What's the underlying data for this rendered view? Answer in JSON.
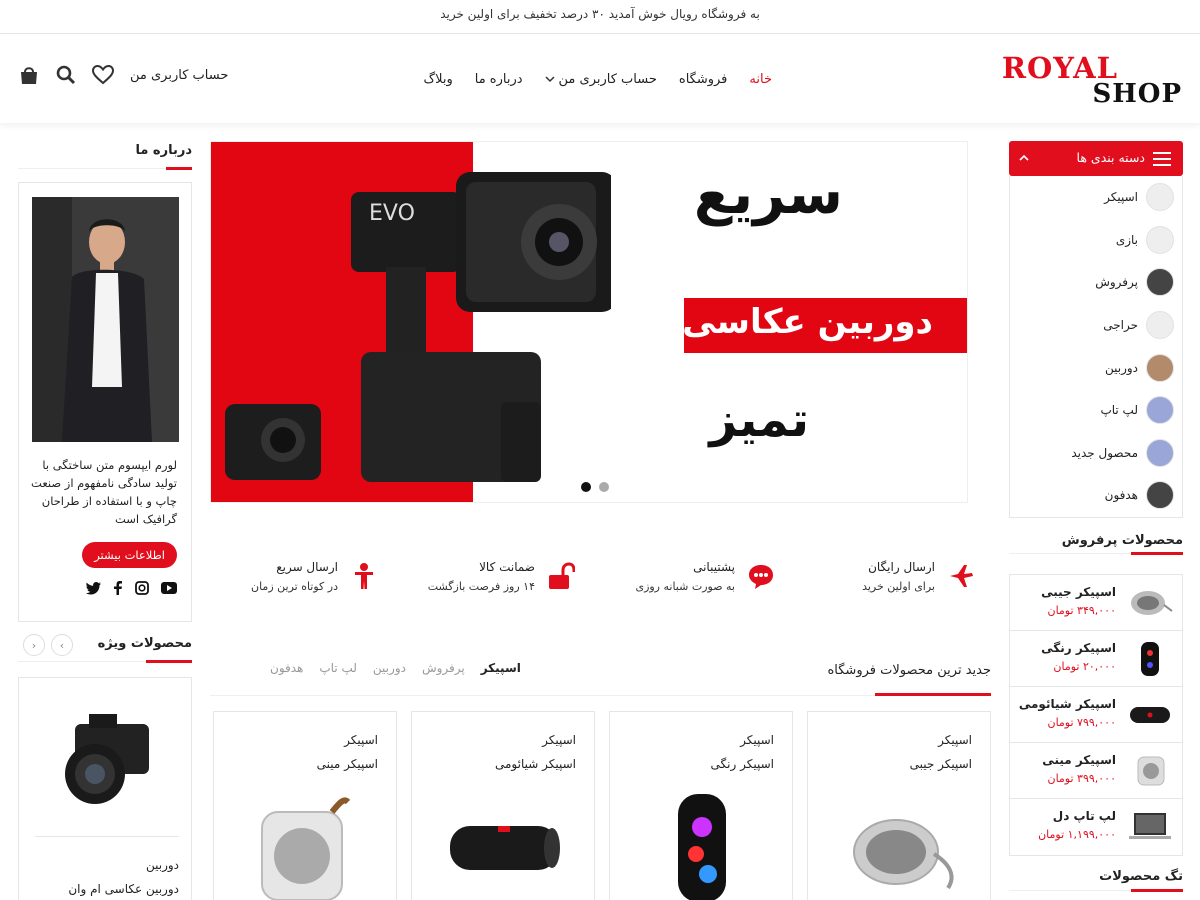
{
  "topbar": {
    "text": "به فروشگاه رویال خوش آمدید ۳۰ درصد تخفیف برای اولین خرید"
  },
  "header": {
    "logo_top": "ROYAL",
    "logo_bottom": "SHOP",
    "nav": [
      "خانه",
      "فروشگاه",
      "حساب کاربری من",
      "درباره ما",
      "وبلاگ"
    ],
    "account_label": "حساب کاربری من"
  },
  "categories": {
    "title": "دسته بندی ها",
    "items": [
      "اسپیکر",
      "بازی",
      "پرفروش",
      "حراجی",
      "دوربین",
      "لپ تاپ",
      "محصول جدید",
      "هدفون"
    ]
  },
  "bestsellers": {
    "title": "محصولات پرفروش",
    "items": [
      {
        "name": "اسپیکر جیبی",
        "price": "۳۴۹,۰۰۰ تومان"
      },
      {
        "name": "اسپیکر رنگی",
        "price": "۲۰,۰۰۰ تومان"
      },
      {
        "name": "اسپیکر شیائومی",
        "price": "۷۹۹,۰۰۰ تومان"
      },
      {
        "name": "اسپیکر مینی",
        "price": "۳۹۹,۰۰۰ تومان"
      },
      {
        "name": "لپ تاپ دل",
        "price": "۱,۱۹۹,۰۰۰ تومان"
      }
    ]
  },
  "tags": {
    "title": "تگ محصولات"
  },
  "slider": {
    "headline_1": "سریع",
    "headline_2": "دوربین عکاسی",
    "headline_3": "تمیز"
  },
  "features": [
    {
      "title": "ارسال رایگان",
      "sub": "برای اولین خرید"
    },
    {
      "title": "پشتیبانی",
      "sub": "به صورت شبانه روزی"
    },
    {
      "title": "ضمانت کالا",
      "sub": "۱۴ روز فرصت بازگشت"
    },
    {
      "title": "ارسال سریع",
      "sub": "در کوتاه ترین زمان"
    }
  ],
  "latest": {
    "title": "جدید ترین محصولات فروشگاه",
    "tabs": [
      "اسپیکر",
      "پرفروش",
      "دوربین",
      "لپ تاپ",
      "هدفون"
    ],
    "products": [
      {
        "cat": "اسپیکر",
        "name": "اسپیکر جیبی"
      },
      {
        "cat": "اسپیکر",
        "name": "اسپیکر رنگی"
      },
      {
        "cat": "اسپیکر",
        "name": "اسپیکر شیائومی"
      },
      {
        "cat": "اسپیکر",
        "name": "اسپیکر مینی"
      }
    ]
  },
  "about": {
    "title": "درباره ما",
    "text": "لورم ایپسوم متن ساختگی با تولید سادگی نامفهوم از صنعت چاپ و با استفاده از طراحان گرافیک است",
    "button": "اطلاعات بیشتر"
  },
  "special": {
    "title": "محصولات ویژه",
    "category": "دوربین",
    "product": "دوربین عکاسی ام وان"
  },
  "colors": {
    "accent": "#e10f1e"
  }
}
